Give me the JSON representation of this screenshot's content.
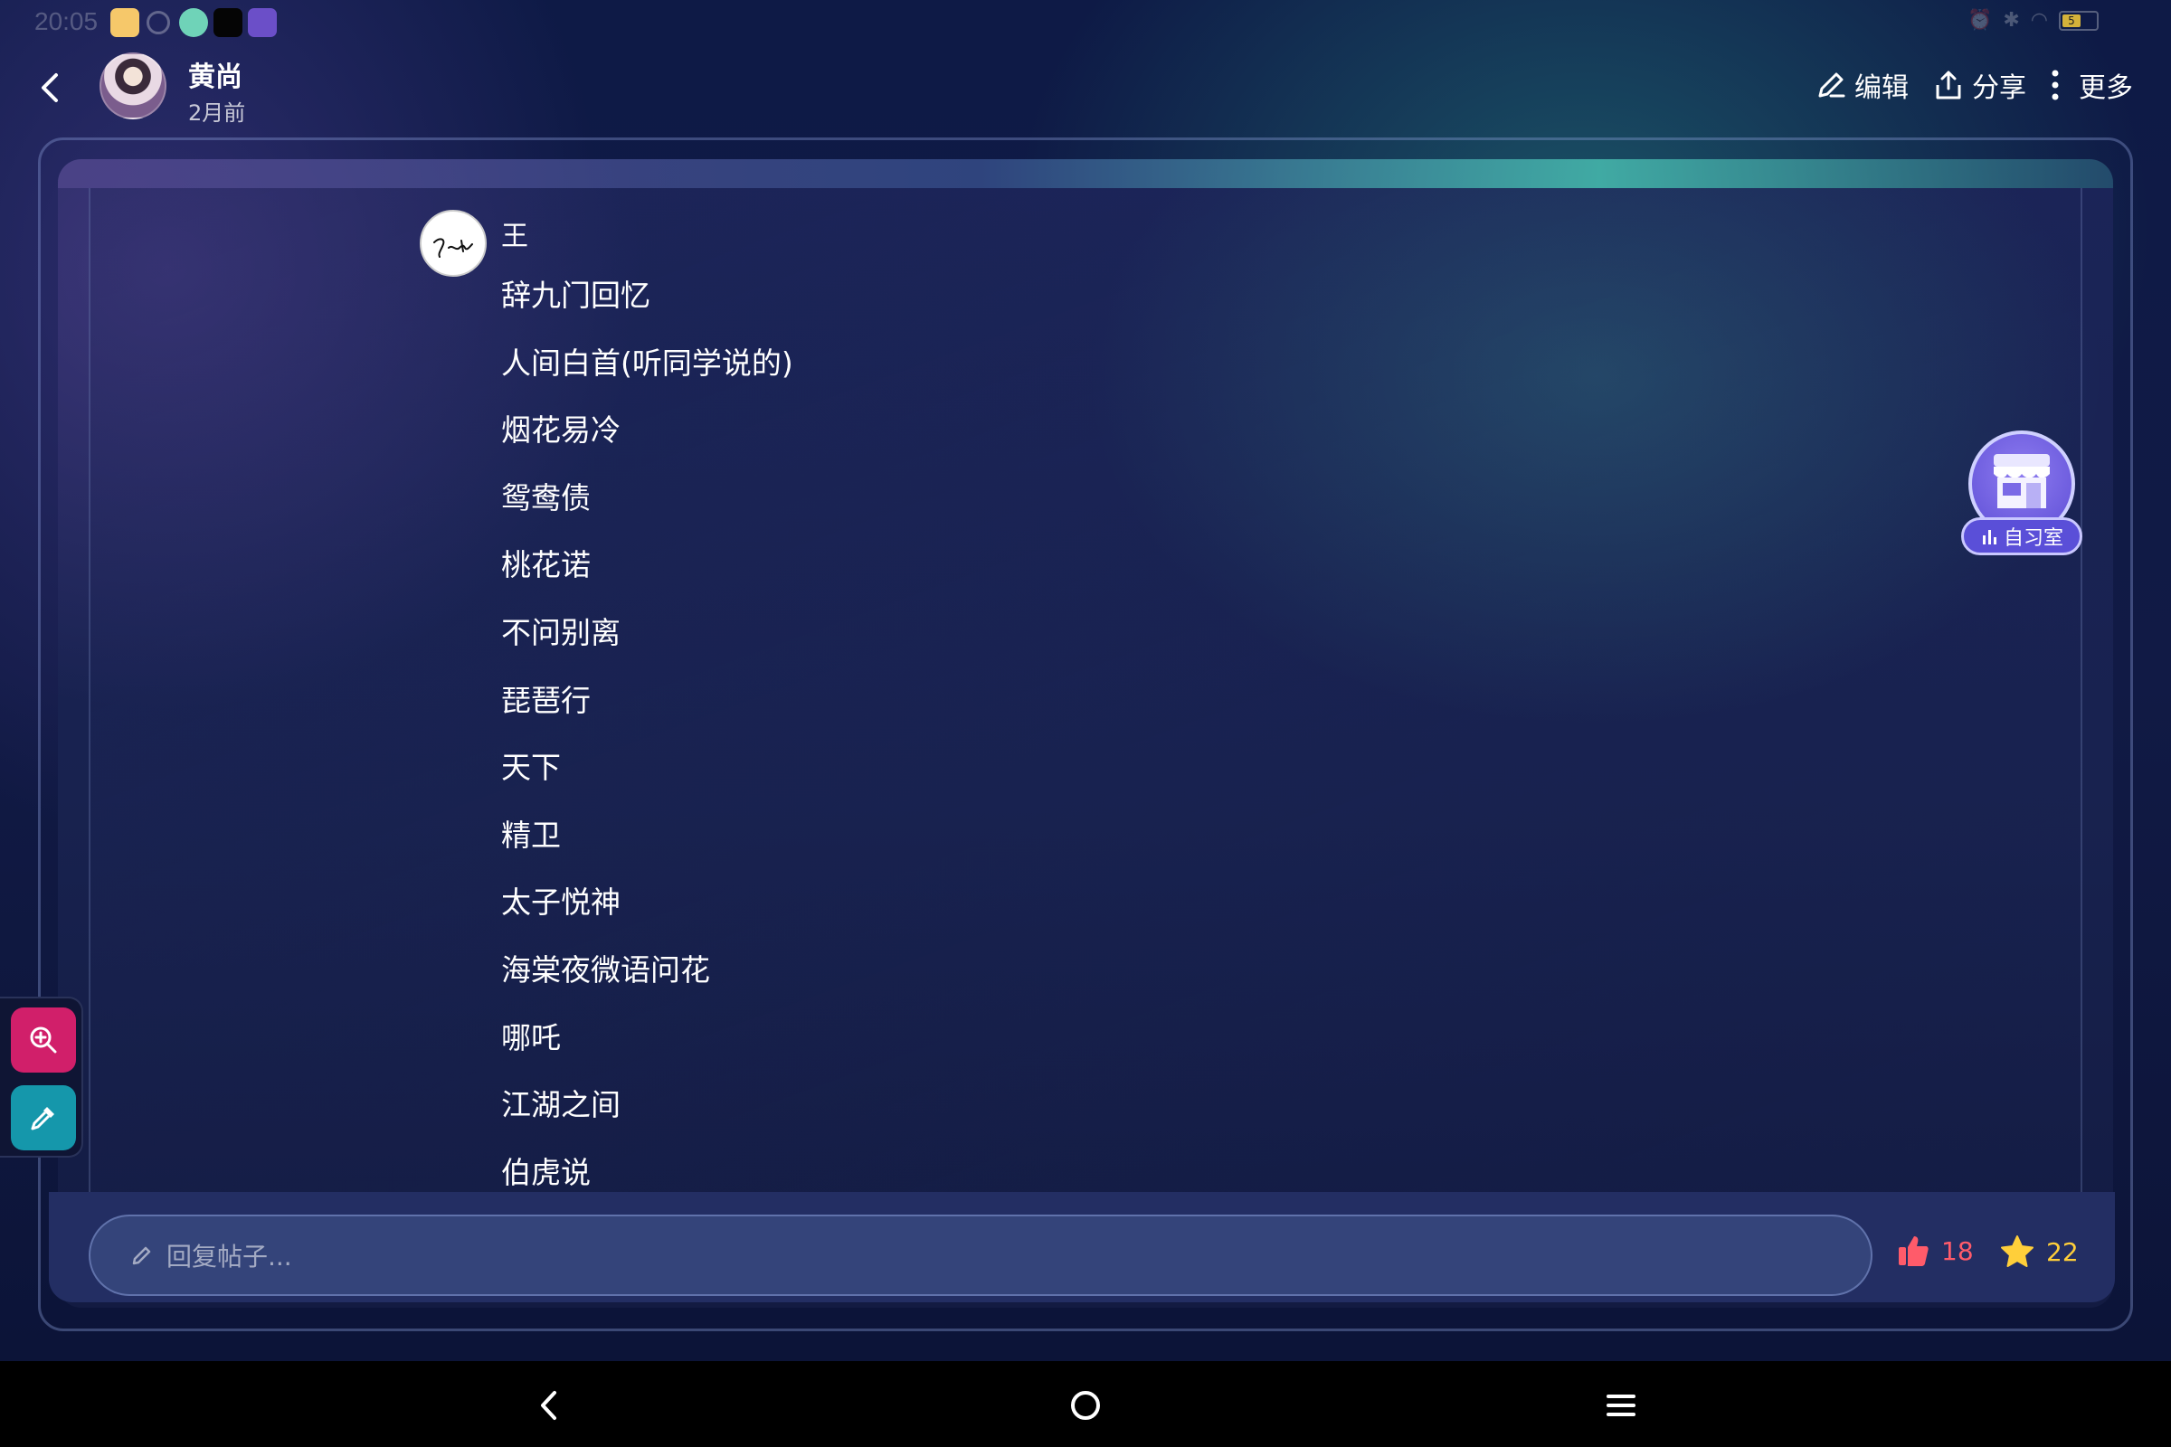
{
  "status_bar": {
    "time": "20:05",
    "battery": "5"
  },
  "header": {
    "author": "黄尚",
    "post_time": "2月前",
    "actions": {
      "edit": "编辑",
      "share": "分享",
      "more": "更多"
    }
  },
  "post": {
    "author": "王",
    "lines": [
      "辞九门回忆",
      "人间白首(听同学说的)",
      "烟花易冷",
      "鸳鸯债",
      "桃花诺",
      "不问别离",
      "琵琶行",
      "天下",
      "精卫",
      "太子悦神",
      "海棠夜微语问花",
      "哪吒",
      "江湖之间",
      "伯虎说"
    ]
  },
  "study_room": {
    "label": "自习室"
  },
  "reply": {
    "placeholder": "回复帖子...",
    "likes": "18",
    "favorites": "22"
  },
  "colors": {
    "like": "#ff5b6a",
    "favorite": "#ffcf3a",
    "zoom_tool": "#d11f6a",
    "pick_tool": "#1597ab"
  }
}
